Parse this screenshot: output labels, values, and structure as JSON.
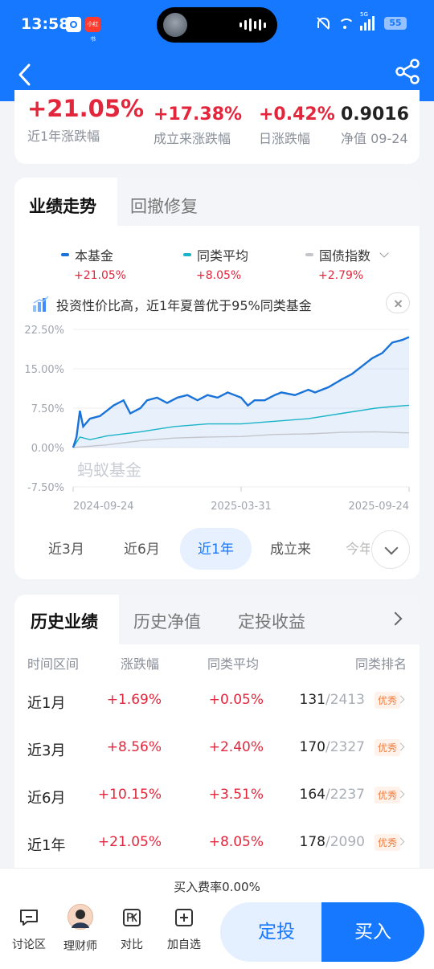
{
  "status_bar": {
    "time": "13:58",
    "app2_label": "小红书",
    "network": "5G",
    "battery": "55"
  },
  "header": {
    "back_icon": "back-arrow-icon",
    "share_icon": "share-icon"
  },
  "stats": [
    {
      "value": "+21.05%",
      "label": "近1年涨跌幅"
    },
    {
      "value": "+17.38%",
      "label": "成立来涨跌幅"
    },
    {
      "value": "+0.42%",
      "label": "日涨跌幅"
    },
    {
      "value": "0.9016",
      "label": "净值 09-24"
    }
  ],
  "trend": {
    "tabs": [
      "业绩走势",
      "回撤修复"
    ],
    "legend": [
      {
        "name": "本基金",
        "value": "+21.05%",
        "color": "#1a73d9"
      },
      {
        "name": "同类平均",
        "value": "+8.05%",
        "color": "#1bb3c8"
      },
      {
        "name": "国债指数",
        "value": "+2.79%",
        "color": "#c4c6cc"
      }
    ],
    "tip": "投资性价比高，近1年夏普优于95%同类基金",
    "watermark": "蚂蚁基金",
    "periods": [
      "近3月",
      "近6月",
      "近1年",
      "成立来",
      "今年"
    ]
  },
  "chart_data": {
    "type": "line",
    "x_ticks": [
      "2024-09-24",
      "2025-03-31",
      "2025-09-24"
    ],
    "y_ticks": [
      "22.50%",
      "15.00%",
      "7.50%",
      "0.00%",
      "-7.50%"
    ],
    "ylim": [
      -7.5,
      22.5
    ],
    "y_unit": "%",
    "series": [
      {
        "name": "本基金",
        "color": "#1a73d9",
        "points": [
          [
            0,
            0
          ],
          [
            0.01,
            2
          ],
          [
            0.02,
            7
          ],
          [
            0.03,
            4
          ],
          [
            0.05,
            5.5
          ],
          [
            0.08,
            6
          ],
          [
            0.1,
            7
          ],
          [
            0.12,
            8
          ],
          [
            0.15,
            9
          ],
          [
            0.17,
            6.5
          ],
          [
            0.2,
            7.5
          ],
          [
            0.22,
            9
          ],
          [
            0.25,
            9.5
          ],
          [
            0.28,
            8.5
          ],
          [
            0.31,
            9.5
          ],
          [
            0.34,
            10
          ],
          [
            0.37,
            9
          ],
          [
            0.4,
            10
          ],
          [
            0.43,
            9.5
          ],
          [
            0.46,
            10.5
          ],
          [
            0.5,
            9.5
          ],
          [
            0.52,
            8
          ],
          [
            0.54,
            9
          ],
          [
            0.57,
            9
          ],
          [
            0.6,
            10
          ],
          [
            0.62,
            10.5
          ],
          [
            0.66,
            10
          ],
          [
            0.7,
            11
          ],
          [
            0.72,
            10.5
          ],
          [
            0.76,
            11.5
          ],
          [
            0.8,
            13
          ],
          [
            0.83,
            14
          ],
          [
            0.86,
            15.5
          ],
          [
            0.89,
            17
          ],
          [
            0.92,
            18
          ],
          [
            0.95,
            20
          ],
          [
            0.98,
            20.5
          ],
          [
            1,
            21.05
          ]
        ]
      },
      {
        "name": "同类平均",
        "color": "#1bb3c8",
        "points": [
          [
            0,
            0
          ],
          [
            0.01,
            1
          ],
          [
            0.02,
            2
          ],
          [
            0.05,
            1.5
          ],
          [
            0.1,
            2.2
          ],
          [
            0.2,
            3
          ],
          [
            0.3,
            4
          ],
          [
            0.4,
            4.5
          ],
          [
            0.5,
            4.5
          ],
          [
            0.6,
            5
          ],
          [
            0.7,
            5.5
          ],
          [
            0.8,
            6.5
          ],
          [
            0.9,
            7.5
          ],
          [
            0.95,
            7.8
          ],
          [
            1,
            8.05
          ]
        ]
      },
      {
        "name": "国债指数",
        "color": "#c4c6cc",
        "points": [
          [
            0,
            0
          ],
          [
            0.1,
            0.5
          ],
          [
            0.2,
            1.3
          ],
          [
            0.3,
            1.8
          ],
          [
            0.4,
            2
          ],
          [
            0.5,
            2.1
          ],
          [
            0.6,
            2.5
          ],
          [
            0.7,
            2.6
          ],
          [
            0.8,
            2.9
          ],
          [
            0.9,
            3
          ],
          [
            1,
            2.79
          ]
        ]
      }
    ]
  },
  "history": {
    "tabs": [
      "历史业绩",
      "历史净值",
      "定投收益"
    ],
    "columns": [
      "时间区间",
      "涨跌幅",
      "同类平均",
      "同类排名"
    ],
    "rows": [
      {
        "period": "近1月",
        "change": "+1.69%",
        "avg": "+0.05%",
        "rank": "131",
        "total": "/2413",
        "badge": "优秀"
      },
      {
        "period": "近3月",
        "change": "+8.56%",
        "avg": "+2.40%",
        "rank": "170",
        "total": "/2327",
        "badge": "优秀"
      },
      {
        "period": "近6月",
        "change": "+10.15%",
        "avg": "+3.51%",
        "rank": "164",
        "total": "/2237",
        "badge": "优秀"
      },
      {
        "period": "近1年",
        "change": "+21.05%",
        "avg": "+8.05%",
        "rank": "178",
        "total": "/2090",
        "badge": "优秀"
      }
    ]
  },
  "bottom": {
    "fee": "买入费率0.00%",
    "nav": [
      "讨论区",
      "理财师",
      "对比",
      "加自选"
    ],
    "sip": "定投",
    "buy": "买入"
  },
  "colors": {
    "primary": "#1677ff",
    "up": "#e3263c"
  }
}
